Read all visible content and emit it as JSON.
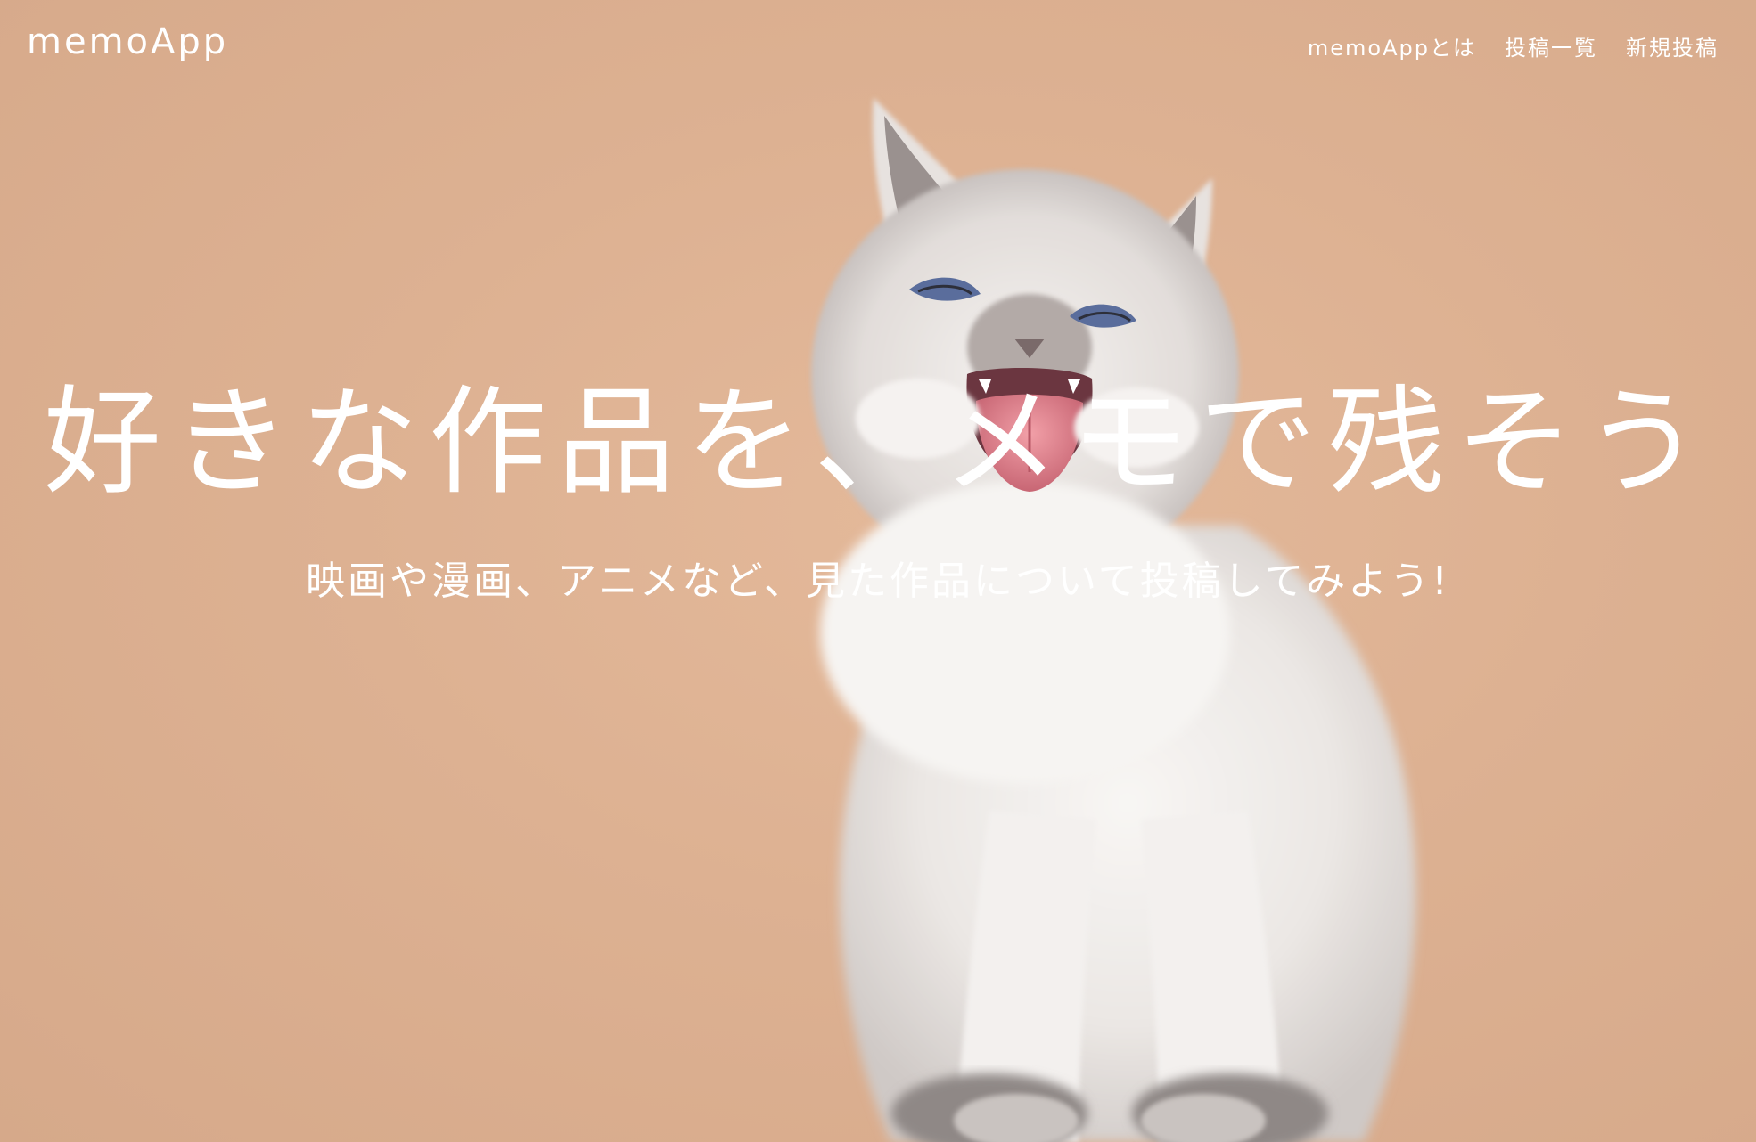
{
  "nav": {
    "logo": "memoApp",
    "links": [
      {
        "label": "memoAppとは"
      },
      {
        "label": "投稿一覧"
      },
      {
        "label": "新規投稿"
      }
    ]
  },
  "hero": {
    "headline": "好きな作品を、メモで残そう",
    "subline": "映画や漫画、アニメなど、見た作品について投稿してみよう!",
    "background_color": "#ddb192",
    "text_color": "#ffffff"
  }
}
